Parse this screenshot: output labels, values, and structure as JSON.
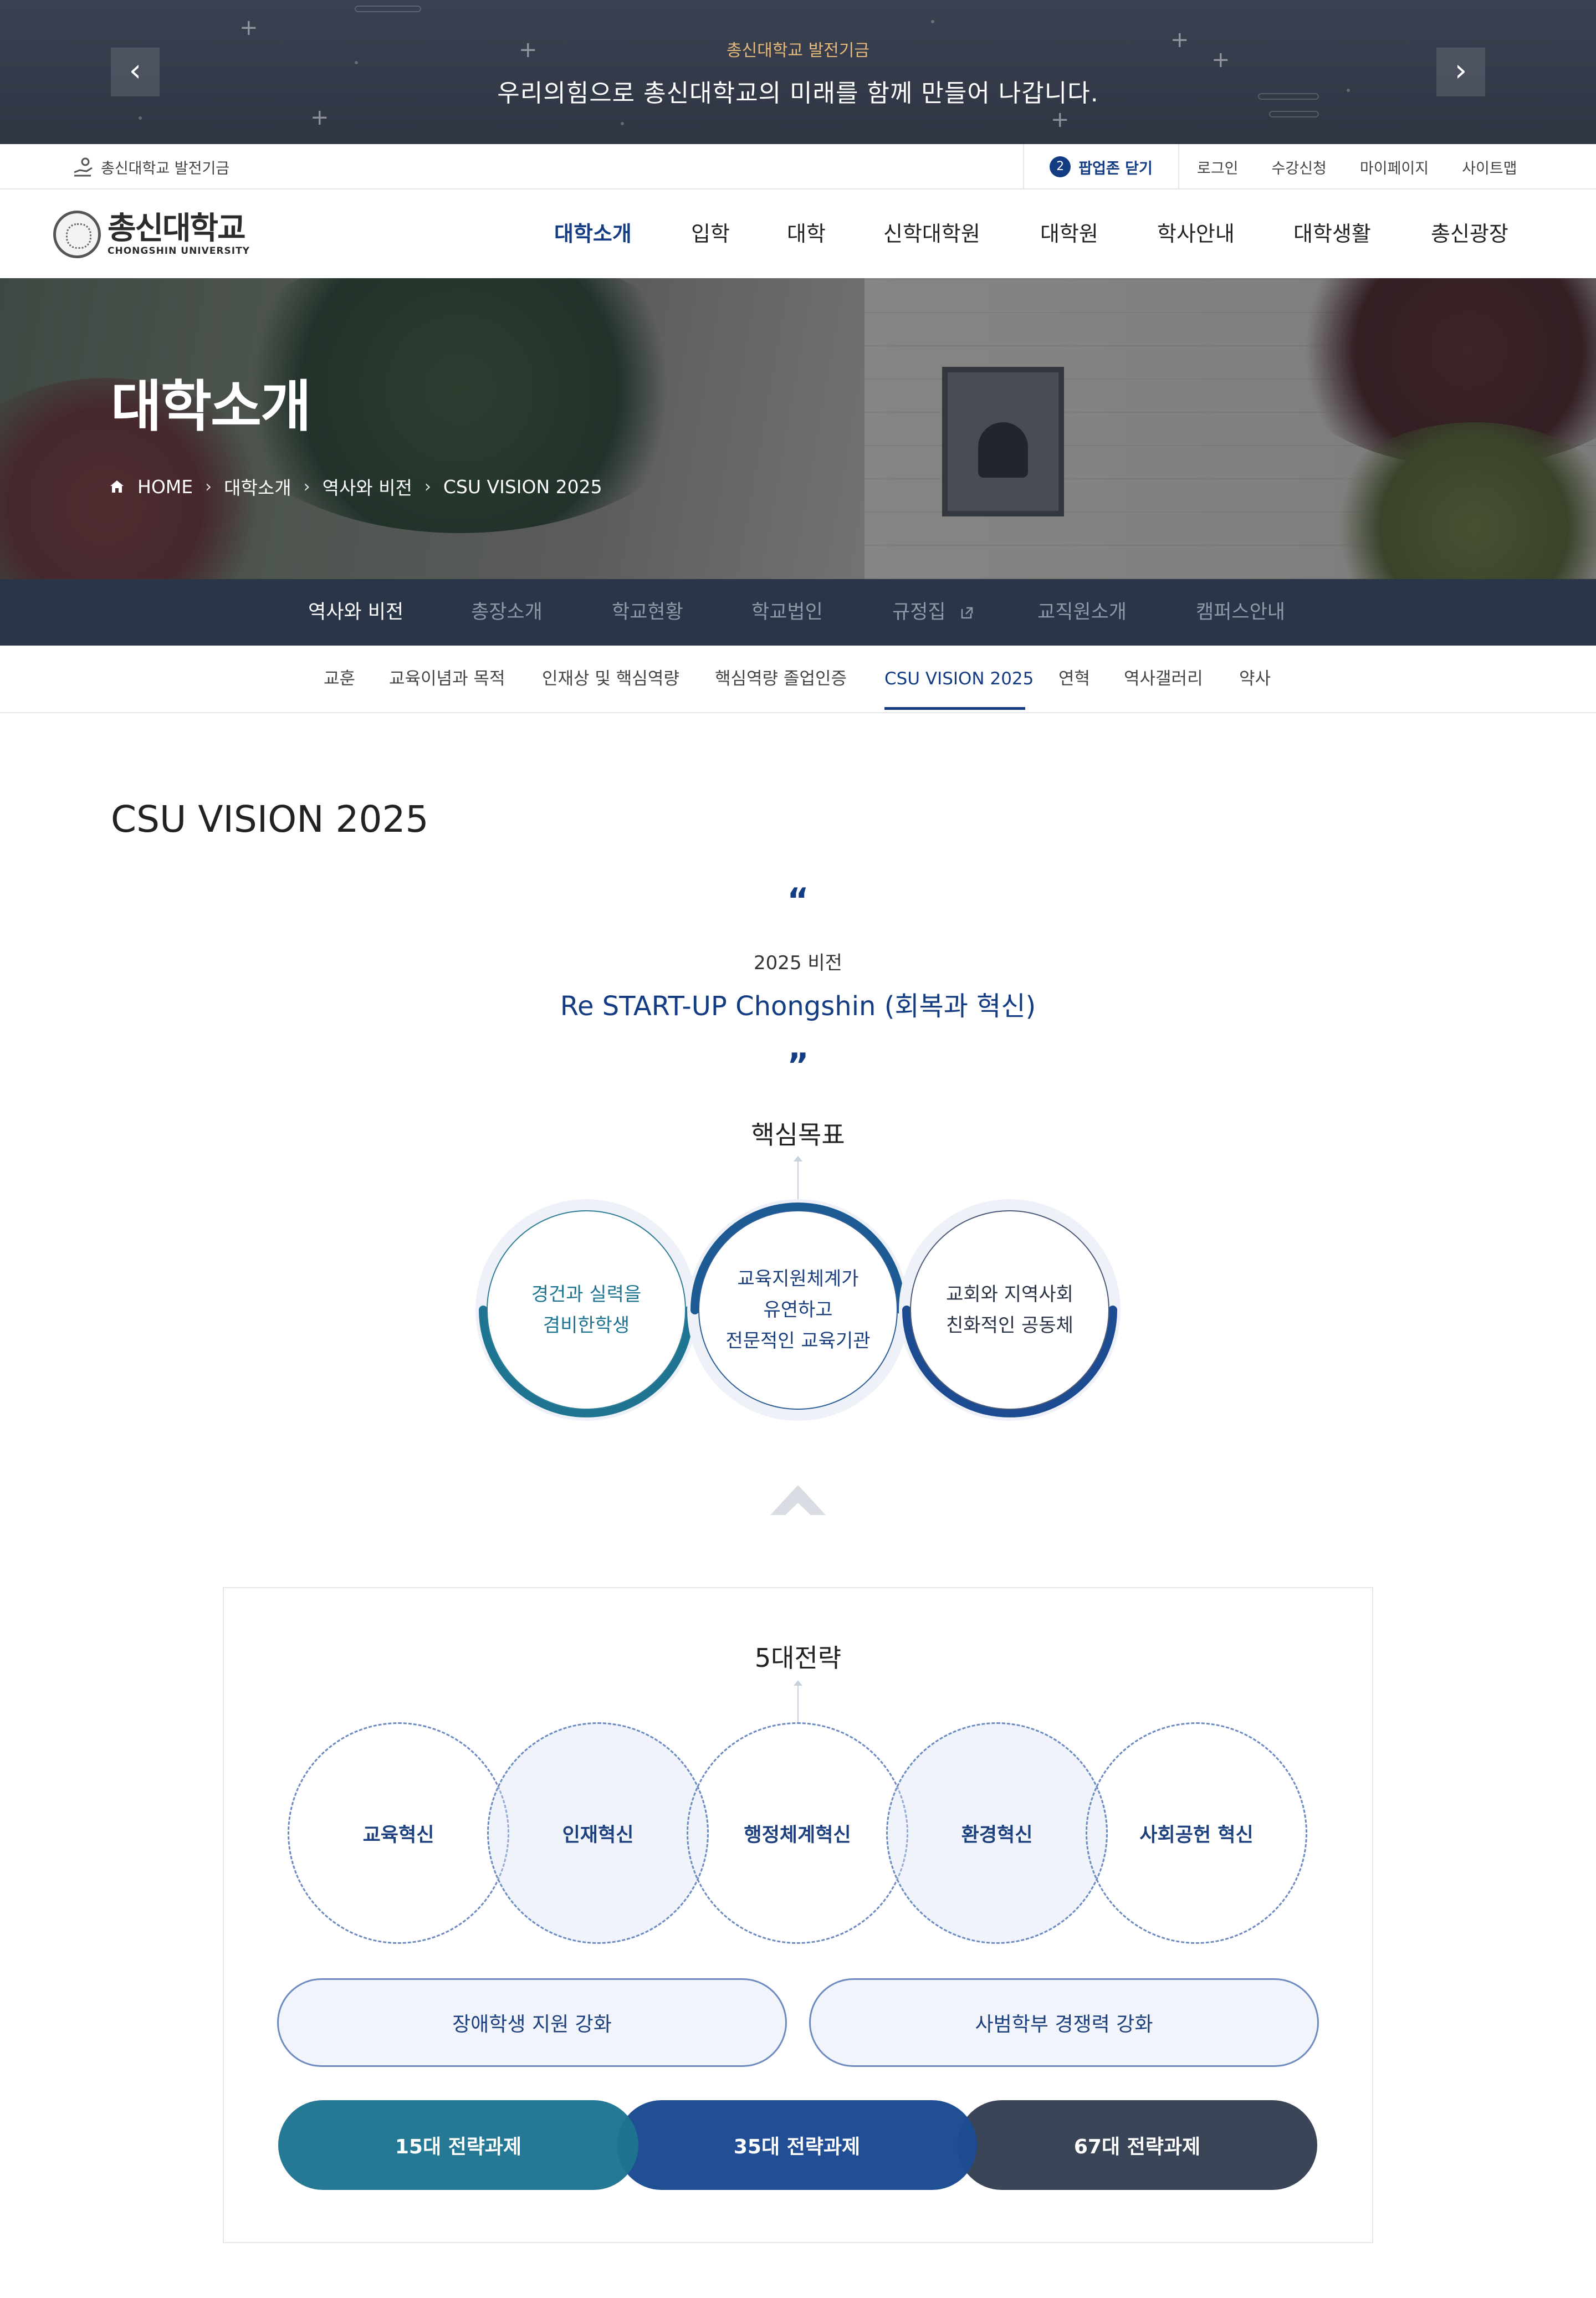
{
  "popup": {
    "subtitle": "총신대학교 발전기금",
    "message": "우리의힘으로 총신대학교의 미래를 함께 만들어 나갑니다.",
    "prev_icon": "chevron-left-icon",
    "next_icon": "chevron-right-icon"
  },
  "utility": {
    "fund_label": "총신대학교 발전기금",
    "popup_count": "2",
    "popup_close": "팝업존 닫기",
    "links": [
      "로그인",
      "수강신청",
      "마이페이지",
      "사이트맵"
    ]
  },
  "logo": {
    "kor": "총신대학교",
    "eng": "CHONGSHIN UNIVERSITY"
  },
  "gnb": [
    "대학소개",
    "입학",
    "대학",
    "신학대학원",
    "대학원",
    "학사안내",
    "대학생활",
    "총신광장"
  ],
  "hero": {
    "title": "대학소개",
    "breadcrumb": [
      "HOME",
      "대학소개",
      "역사와 비전",
      "CSU VISION 2025"
    ]
  },
  "subnav": [
    "역사와 비전",
    "총장소개",
    "학교현황",
    "학교법인",
    "규정집",
    "교직원소개",
    "캠퍼스안내"
  ],
  "tabs": [
    "교훈",
    "교육이념과 목적",
    "인재상 및 핵심역량",
    "핵심역량 졸업인증",
    "CSU VISION 2025",
    "연혁",
    "역사갤러리",
    "약사"
  ],
  "content": {
    "page_title": "CSU VISION 2025",
    "open_quote": "“",
    "close_quote": "”",
    "vision_label": "2025 비전",
    "vision_slogan": "Re START-UP Chongshin (회복과 혁신)",
    "goals_title": "핵심목표",
    "goals": [
      "경건과 실력을\n겸비한학생",
      "교육지원체계가\n유연하고\n전문적인 교육기관",
      "교회와 지역사회\n친화적인 공동체"
    ],
    "strategies_title": "5대전략",
    "strategies": [
      "교육혁신",
      "인재혁신",
      "행정체계혁신",
      "환경혁신",
      "사회공헌 혁신"
    ],
    "extras": [
      "장애학생 지원 강화",
      "사범학부 경쟁력 강화"
    ],
    "tasks": [
      "15대 전략과제",
      "35대 전략과제",
      "67대 전략과제"
    ]
  },
  "colors": {
    "brand_navy": "#143c82",
    "teal": "#1f7591",
    "blue": "#1d4b92",
    "slate": "#3b4558",
    "subnav_bg": "#2b3548",
    "popup_accent": "#e5b97a"
  }
}
